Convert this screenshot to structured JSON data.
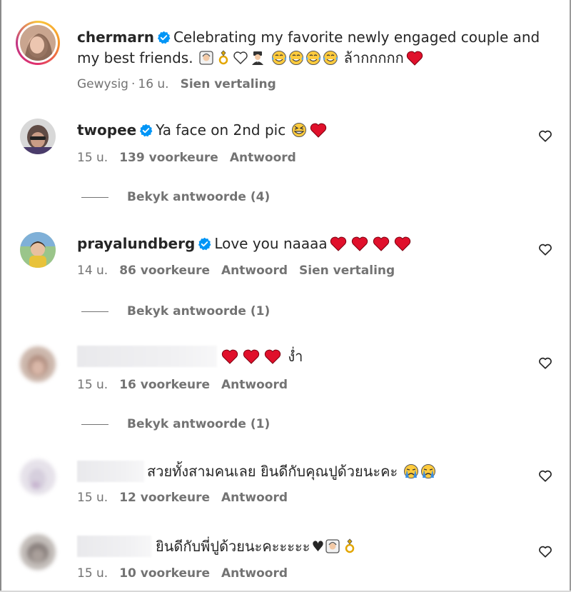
{
  "caption": {
    "username": "chermarn",
    "text": "Celebrating my favorite newly engaged couple and",
    "text2": "my best friends.",
    "thai_tail": "ล้ากกกกก",
    "edited": "Gewysig",
    "time": "16 u.",
    "translate": "Sien vertaling"
  },
  "comments": [
    {
      "username": "twopee",
      "text": "Ya face on 2nd pic",
      "time": "15 u.",
      "likes": "139 voorkeure",
      "reply": "Antwoord",
      "view_replies": "Bekyk antwoorde (4)"
    },
    {
      "username": "prayalundberg",
      "text": "Love you naaaa",
      "time": "14 u.",
      "likes": "86 voorkeure",
      "reply": "Antwoord",
      "translate": "Sien vertaling",
      "view_replies": "Bekyk antwoorde (1)"
    },
    {
      "username": "",
      "text": "ง่ำ",
      "time": "15 u.",
      "likes": "16 voorkeure",
      "reply": "Antwoord",
      "view_replies": "Bekyk antwoorde (1)"
    },
    {
      "username": "",
      "text": "สวยทั้งสามคนเลย ยินดีกับคุณปูด้วยนะคะ",
      "time": "15 u.",
      "likes": "12 voorkeure",
      "reply": "Antwoord"
    },
    {
      "username": "",
      "text": "ยินดีกับพี่ปูด้วยนะคะะะะะ",
      "time": "15 u.",
      "likes": "10 voorkeure",
      "reply": "Antwoord"
    }
  ],
  "icons": {
    "verified": "verified-badge-icon",
    "like": "heart-outline-icon",
    "red_heart": "red-heart-emoji",
    "colors": {
      "verified_blue": "#0095f6",
      "heart_red": "#e0102b",
      "muted": "#737373",
      "text": "#262626"
    }
  }
}
